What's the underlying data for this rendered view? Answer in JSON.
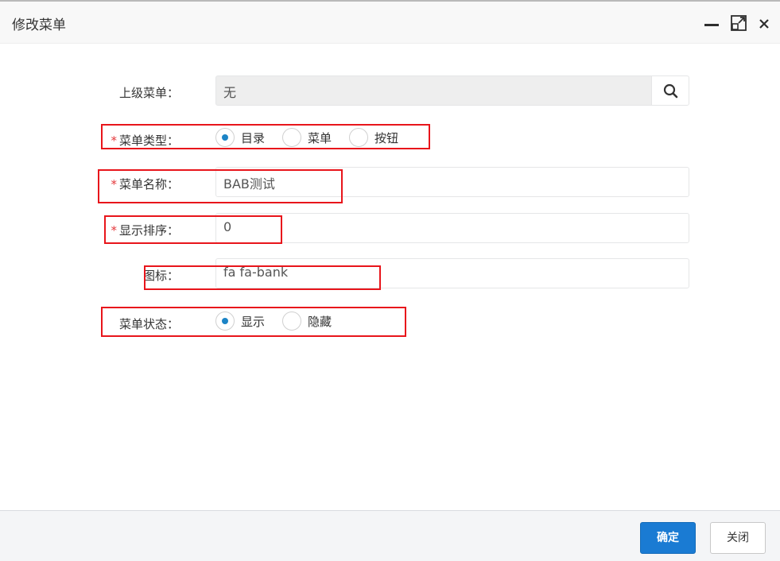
{
  "dialog": {
    "title": "修改菜单",
    "window_controls": [
      "minimize-icon",
      "maximize-icon",
      "close-icon"
    ]
  },
  "form": {
    "parent_menu": {
      "label": "上级菜单：",
      "value": "无",
      "search_icon": "search-icon"
    },
    "menu_type": {
      "label": "菜单类型：",
      "required_mark": "*",
      "options": [
        "目录",
        "菜单",
        "按钮"
      ],
      "selected": "目录"
    },
    "menu_name": {
      "label": "菜单名称：",
      "required_mark": "*",
      "value": "BAB测试"
    },
    "display_order": {
      "label": "显示排序：",
      "required_mark": "*",
      "value": "0"
    },
    "icon": {
      "label": "图标：",
      "value": "fa fa-bank"
    },
    "menu_status": {
      "label": "菜单状态：",
      "options": [
        "显示",
        "隐藏"
      ],
      "selected": "显示"
    }
  },
  "footer": {
    "confirm_label": "确定",
    "close_label": "关闭"
  },
  "colors": {
    "accent": "#1a7bd3",
    "radio_dot": "#1c84c6",
    "required": "#e4393c",
    "highlight_box": "#e8151b"
  }
}
